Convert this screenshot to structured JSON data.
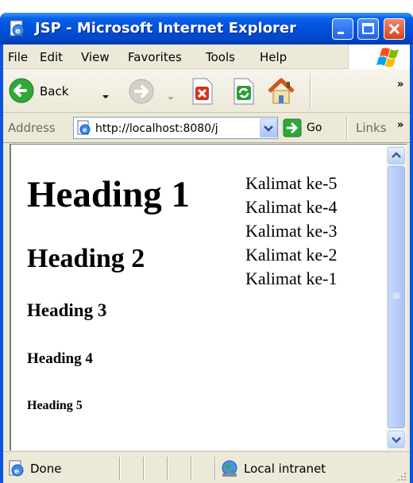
{
  "window": {
    "title": "JSP - Microsoft Internet Explorer",
    "title_bar_color": "#0054e3",
    "close_button_color": "#e0522b"
  },
  "menu": {
    "items": [
      {
        "label": "File"
      },
      {
        "label": "Edit"
      },
      {
        "label": "View"
      },
      {
        "label": "Favorites"
      },
      {
        "label": "Tools"
      },
      {
        "label": "Help"
      }
    ]
  },
  "toolbar": {
    "back_label": "Back",
    "icons": [
      "back-arrow-icon",
      "forward-arrow-icon",
      "stop-icon",
      "refresh-icon",
      "home-icon"
    ]
  },
  "address": {
    "label": "Address",
    "url": "http://localhost:8080/j",
    "go_label": "Go",
    "links_label": "Links"
  },
  "page": {
    "headings": [
      "Heading 1",
      "Heading 2",
      "Heading 3",
      "Heading 4",
      "Heading 5"
    ],
    "sentences": [
      "Kalimat ke-5",
      "Kalimat ke-4",
      "Kalimat ke-3",
      "Kalimat ke-2",
      "Kalimat ke-1"
    ]
  },
  "status": {
    "text": "Done",
    "zone": "Local intranet"
  },
  "colors": {
    "content_background": "#ffffff",
    "chrome_background": "#ece9d8",
    "scrollbar_thumb": "#b8cdf8"
  }
}
